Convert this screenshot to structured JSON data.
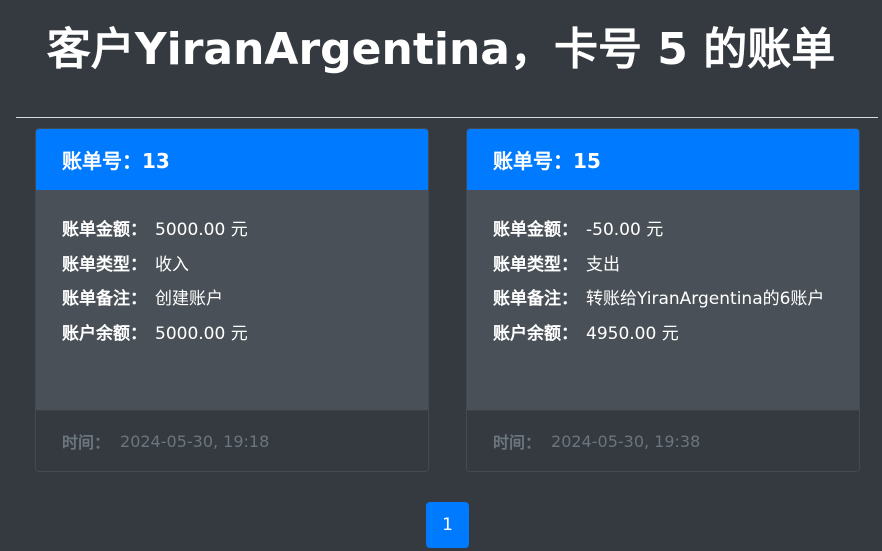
{
  "page": {
    "title": "客户YiranArgentina，卡号 5 的账单"
  },
  "labels": {
    "amount": "账单金额：",
    "type": "账单类型：",
    "note": "账单备注：",
    "balance": "账户余额：",
    "time": "时间："
  },
  "bills": [
    {
      "header": "账单号：13",
      "amount": "5000.00 元",
      "type": "收入",
      "note": "创建账户",
      "balance": "5000.00 元",
      "time": "2024-05-30, 19:18"
    },
    {
      "header": "账单号：15",
      "amount": "-50.00 元",
      "type": "支出",
      "note": "转账给YiranArgentina的6账户",
      "balance": "4950.00 元",
      "time": "2024-05-30, 19:38"
    }
  ],
  "pagination": {
    "current_page": "1"
  },
  "colors": {
    "background": "#343a40",
    "card_header": "#007bff",
    "card_body": "#495057",
    "footer_text": "#6c757d"
  }
}
